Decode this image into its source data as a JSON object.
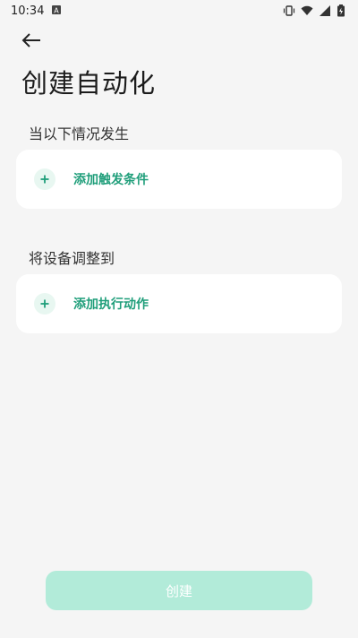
{
  "status_bar": {
    "time": "10:34"
  },
  "header": {
    "title": "创建自动化"
  },
  "condition_section": {
    "label": "当以下情况发生",
    "add_label": "添加触发条件"
  },
  "action_section": {
    "label": "将设备调整到",
    "add_label": "添加执行动作"
  },
  "footer": {
    "create_label": "创建"
  },
  "colors": {
    "accent": "#1f9e7a",
    "button_disabled": "#b2ebd9",
    "background": "#f5f5f5"
  }
}
